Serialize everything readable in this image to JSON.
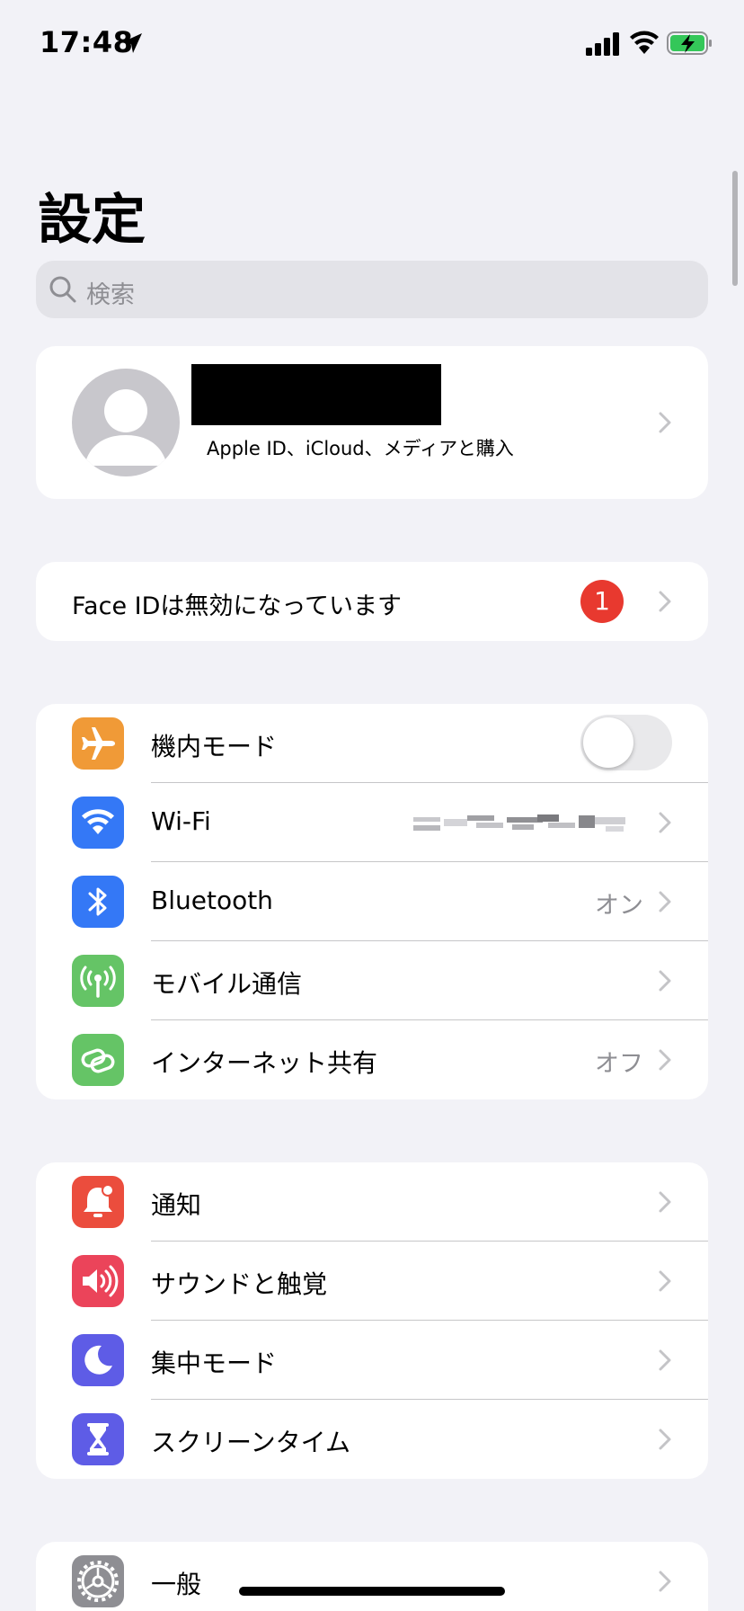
{
  "status_bar": {
    "time": "17:48",
    "icons": [
      "location-arrow-icon",
      "cellular-signal-icon",
      "wifi-icon",
      "battery-charging-icon"
    ]
  },
  "page": {
    "title": "設定"
  },
  "search": {
    "placeholder": "検索"
  },
  "profile": {
    "name_redacted": true,
    "subtitle": "Apple ID、iCloud、メディアと購入"
  },
  "faceid": {
    "label": "Face IDは無効になっています",
    "badge": "1"
  },
  "sections": {
    "network": [
      {
        "label": "機内モード",
        "icon": "airplane-icon",
        "color": "#f09a37",
        "toggle": false
      },
      {
        "label": "Wi-Fi",
        "icon": "wifi-icon",
        "color": "#3478f6",
        "value_redacted": true
      },
      {
        "label": "Bluetooth",
        "icon": "bluetooth-icon",
        "color": "#3478f6",
        "value": "オン"
      },
      {
        "label": "モバイル通信",
        "icon": "antenna-icon",
        "color": "#65c466"
      },
      {
        "label": "インターネット共有",
        "icon": "chain-link-icon",
        "color": "#65c466",
        "value": "オフ"
      }
    ],
    "notify": [
      {
        "label": "通知",
        "icon": "bell-icon",
        "color": "#eb4d3d"
      },
      {
        "label": "サウンドと触覚",
        "icon": "speaker-icon",
        "color": "#eb445a"
      },
      {
        "label": "集中モード",
        "icon": "moon-icon",
        "color": "#5e5ce6"
      },
      {
        "label": "スクリーンタイム",
        "icon": "hourglass-icon",
        "color": "#5e5ce6"
      }
    ],
    "general": [
      {
        "label": "一般",
        "icon": "gear-icon",
        "color": "#8e8e93"
      }
    ]
  }
}
